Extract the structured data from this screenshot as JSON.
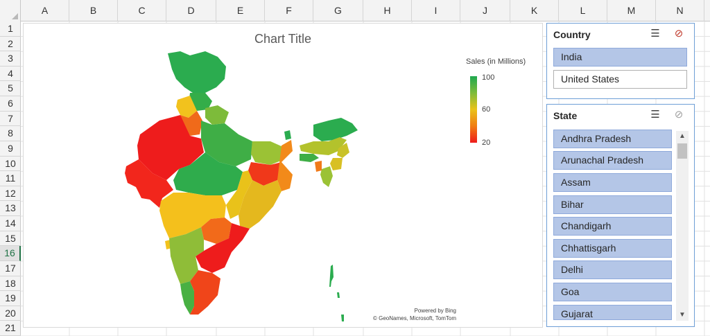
{
  "columns": [
    "A",
    "B",
    "C",
    "D",
    "E",
    "F",
    "G",
    "H",
    "I",
    "J",
    "K",
    "L",
    "M",
    "N"
  ],
  "rows": [
    "1",
    "2",
    "3",
    "4",
    "5",
    "6",
    "7",
    "8",
    "9",
    "10",
    "11",
    "12",
    "13",
    "14",
    "15",
    "16",
    "17",
    "18",
    "19",
    "20",
    "21"
  ],
  "active_row": "16",
  "chart": {
    "title": "Chart Title",
    "legend_title": "Sales (in Millions)",
    "legend_ticks": [
      "100",
      "60",
      "20"
    ],
    "credit_line1": "Powered by Bing",
    "credit_line2": "© GeoNames, Microsoft, TomTom",
    "scale_colors": {
      "high": "#1fa84f",
      "mid": "#e9c21a",
      "low": "#ee1c1c"
    }
  },
  "chart_data": {
    "type": "heatmap",
    "title": "Chart Title",
    "legend_title": "Sales (in Millions)",
    "scale": {
      "min": 20,
      "mid": 60,
      "max": 100
    },
    "regions": [
      {
        "name": "Jammu and Kashmir",
        "color": "#2bac4f"
      },
      {
        "name": "Himachal Pradesh",
        "color": "#34ad49"
      },
      {
        "name": "Punjab",
        "color": "#f2c21d"
      },
      {
        "name": "Haryana",
        "color": "#f06a1a"
      },
      {
        "name": "Uttarakhand",
        "color": "#7dbb3a"
      },
      {
        "name": "Rajasthan",
        "color": "#ee1c1c"
      },
      {
        "name": "Gujarat",
        "color": "#f2261c"
      },
      {
        "name": "Uttar Pradesh",
        "color": "#3fae46"
      },
      {
        "name": "Madhya Pradesh",
        "color": "#2fac4c"
      },
      {
        "name": "Bihar",
        "color": "#9bc235"
      },
      {
        "name": "Jharkhand",
        "color": "#f0381a"
      },
      {
        "name": "West Bengal",
        "color": "#f28a1a"
      },
      {
        "name": "Chhattisgarh",
        "color": "#e9c21a"
      },
      {
        "name": "Odisha",
        "color": "#e4b81e"
      },
      {
        "name": "Maharashtra",
        "color": "#f4c01c"
      },
      {
        "name": "Telangana",
        "color": "#f26a1a"
      },
      {
        "name": "Andhra Pradesh",
        "color": "#ee1c1c"
      },
      {
        "name": "Karnataka",
        "color": "#8fbd38"
      },
      {
        "name": "Goa",
        "color": "#f2c21d"
      },
      {
        "name": "Kerala",
        "color": "#48b043"
      },
      {
        "name": "Tamil Nadu",
        "color": "#f0451a"
      },
      {
        "name": "Sikkim",
        "color": "#2bac4f"
      },
      {
        "name": "Arunachal Pradesh",
        "color": "#2bac4f"
      },
      {
        "name": "Assam",
        "color": "#b3c22c"
      },
      {
        "name": "Meghalaya",
        "color": "#3fae46"
      },
      {
        "name": "Nagaland",
        "color": "#c9c227"
      },
      {
        "name": "Manipur",
        "color": "#d8c024"
      },
      {
        "name": "Mizoram",
        "color": "#9bc235"
      },
      {
        "name": "Tripura",
        "color": "#f07a1a"
      },
      {
        "name": "Andaman and Nicobar Islands",
        "color": "#2bac4f"
      }
    ]
  },
  "country_slicer": {
    "title": "Country",
    "multiselect_icon": "☰",
    "clear_icon": "⊘",
    "items": [
      {
        "label": "India",
        "selected": true
      },
      {
        "label": "United States",
        "selected": false
      }
    ]
  },
  "state_slicer": {
    "title": "State",
    "multiselect_icon": "☰",
    "clear_icon": "⊘",
    "items": [
      {
        "label": "Andhra Pradesh",
        "selected": true
      },
      {
        "label": "Arunachal Pradesh",
        "selected": true
      },
      {
        "label": "Assam",
        "selected": true
      },
      {
        "label": "Bihar",
        "selected": true
      },
      {
        "label": "Chandigarh",
        "selected": true
      },
      {
        "label": "Chhattisgarh",
        "selected": true
      },
      {
        "label": "Delhi",
        "selected": true
      },
      {
        "label": "Goa",
        "selected": true
      },
      {
        "label": "Gujarat",
        "selected": true
      }
    ],
    "scroll_up": "▲",
    "scroll_down": "▼"
  }
}
